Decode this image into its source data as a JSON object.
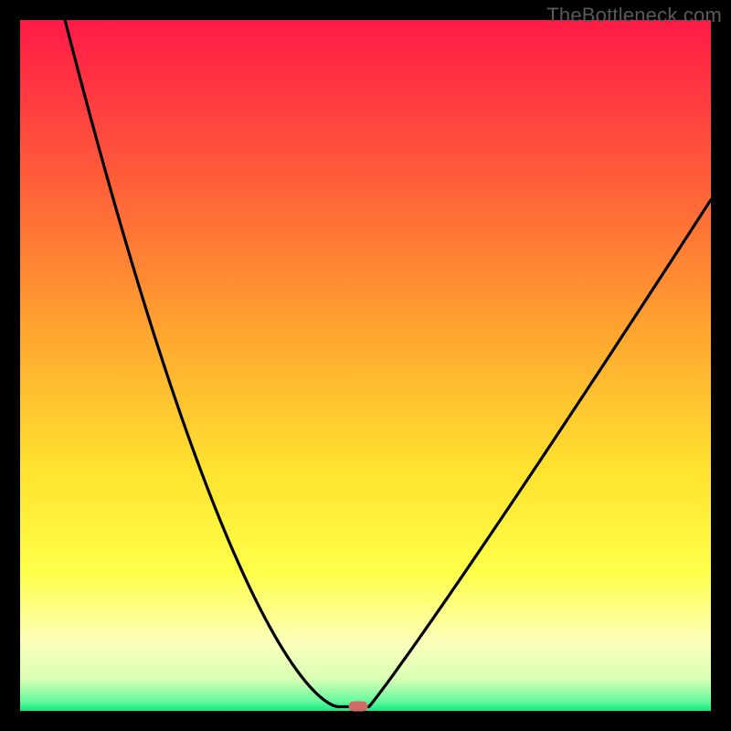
{
  "watermark": "TheBottleneck.com",
  "chart_data": {
    "type": "line",
    "title": "",
    "xlabel": "",
    "ylabel": "",
    "xlim": [
      0,
      100
    ],
    "ylim": [
      0,
      100
    ],
    "background_gradient": {
      "stops": [
        {
          "pos": 0.0,
          "color": "#ff1a47"
        },
        {
          "pos": 0.22,
          "color": "#ff5a3a"
        },
        {
          "pos": 0.45,
          "color": "#ffa52f"
        },
        {
          "pos": 0.65,
          "color": "#ffe22f"
        },
        {
          "pos": 0.8,
          "color": "#ffff4a"
        },
        {
          "pos": 0.9,
          "color": "#fcffba"
        },
        {
          "pos": 0.955,
          "color": "#d7ffb4"
        },
        {
          "pos": 0.985,
          "color": "#69f9a0"
        },
        {
          "pos": 1.0,
          "color": "#14e77f"
        }
      ]
    },
    "branches": {
      "left": {
        "start_x": 6.5,
        "start_y": 100.0,
        "end_x": 46.0,
        "end_y": 0.6
      },
      "right": {
        "start_x": 100.0,
        "start_y": 74.0,
        "end_x": 50.5,
        "end_y": 0.6
      },
      "plateau_y": 0.6,
      "plateau_x": [
        46.0,
        50.5
      ]
    },
    "marker": {
      "x": 49.0,
      "y": 0.6,
      "color": "#cf6a66"
    },
    "series": [
      {
        "name": "curve",
        "x": [
          6.5,
          10,
          14,
          18,
          22,
          26,
          30,
          34,
          38,
          42,
          45,
          46,
          48,
          50.5,
          54,
          58,
          62,
          66,
          70,
          75,
          80,
          85,
          90,
          95,
          100
        ],
        "y": [
          100,
          89,
          78,
          67,
          57,
          47,
          38,
          29,
          20.5,
          11.5,
          4.5,
          0.6,
          0.6,
          0.6,
          5.5,
          13,
          21,
          29,
          36.5,
          45,
          52.5,
          59,
          64.5,
          69.5,
          74
        ]
      }
    ]
  }
}
